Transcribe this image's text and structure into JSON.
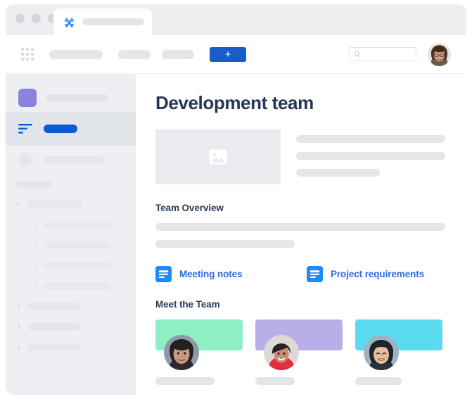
{
  "window": {
    "traffic_lights": [
      "close",
      "minimize",
      "maximize"
    ],
    "tab": {
      "logo_icon": "atlassian-x-logo-icon",
      "title_placeholder": ""
    }
  },
  "toolbar": {
    "app_switcher_icon": "grid-apps-icon",
    "nav_placeholders": [
      "",
      "",
      ""
    ],
    "add_button_label": "+",
    "add_button_color": "#1a5ccc",
    "search": {
      "icon": "search-icon",
      "value": "",
      "placeholder": ""
    },
    "avatar_icon": "user-avatar-photo"
  },
  "sidebar": {
    "space": {
      "icon": "purple-space-square-icon",
      "label_placeholder": ""
    },
    "selected_item": {
      "icon": "list-lines-icon",
      "label_placeholder": "",
      "selected": true
    },
    "people_item": {
      "icon": "circle-avatar-icon",
      "label_placeholder": ""
    },
    "section_label_placeholder": "",
    "tree": [
      {
        "icon": "chevron-down-icon",
        "expanded": true,
        "label_placeholder": "",
        "children": [
          {
            "icon": "bullet-icon",
            "label_placeholder": ""
          },
          {
            "icon": "bullet-icon",
            "label_placeholder": ""
          },
          {
            "icon": "bullet-icon",
            "label_placeholder": ""
          },
          {
            "icon": "bullet-icon",
            "label_placeholder": ""
          }
        ]
      },
      {
        "icon": "chevron-right-icon",
        "expanded": false,
        "label_placeholder": "",
        "children": []
      },
      {
        "icon": "chevron-right-icon",
        "expanded": false,
        "label_placeholder": "",
        "children": []
      },
      {
        "icon": "chevron-right-icon",
        "expanded": false,
        "label_placeholder": "",
        "children": []
      }
    ]
  },
  "main": {
    "page_title": "Development team",
    "hero": {
      "image_placeholder_icon": "image-placeholder-icon",
      "text_lines": 3
    },
    "overview": {
      "heading": "Team Overview",
      "text_lines": 2
    },
    "links": [
      {
        "icon": "document-lines-icon",
        "label": "Meeting notes",
        "color": "#2d6bdb"
      },
      {
        "icon": "document-lines-icon",
        "label": "Project requirements",
        "color": "#2d6bdb"
      }
    ],
    "team": {
      "heading": "Meet the Team",
      "members": [
        {
          "banner_color": "#8fefc4",
          "avatar_icon": "member-avatar-photo",
          "name_placeholder": ""
        },
        {
          "banner_color": "#b9afe8",
          "avatar_icon": "member-avatar-photo",
          "name_placeholder": ""
        },
        {
          "banner_color": "#5bdbef",
          "avatar_icon": "member-avatar-photo",
          "name_placeholder": ""
        }
      ]
    }
  }
}
